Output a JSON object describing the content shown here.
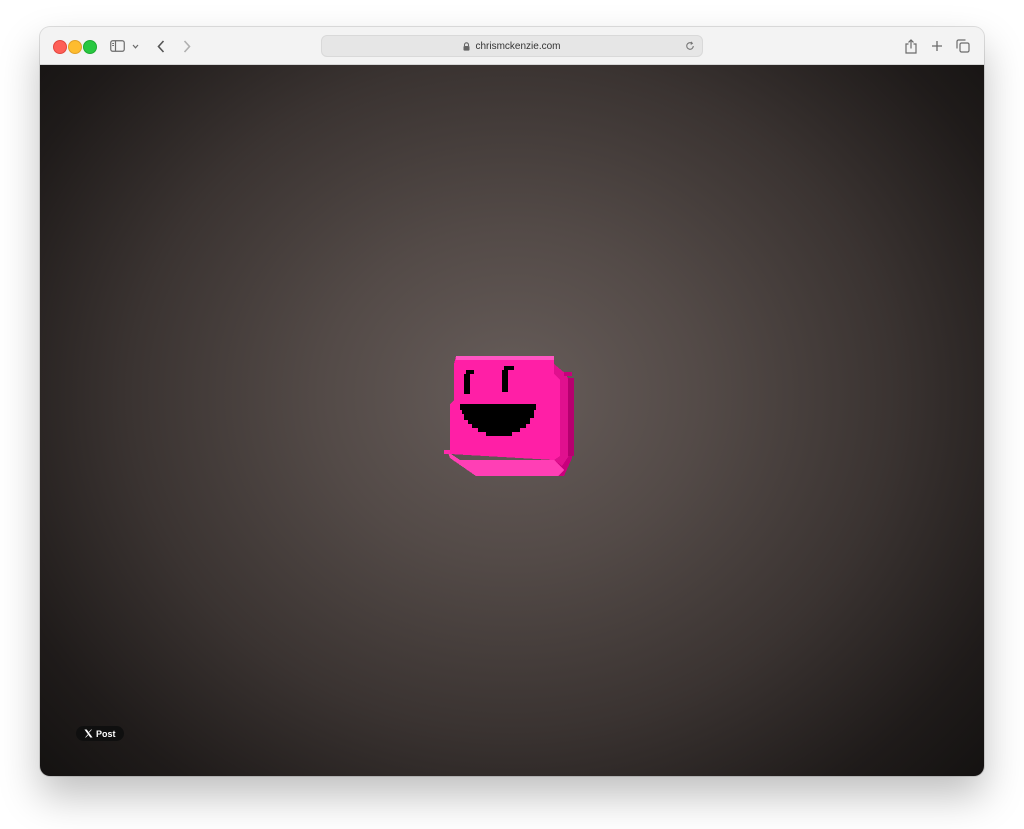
{
  "browser": {
    "url": "chrismckenzie.com"
  },
  "page": {
    "post_button": {
      "label": "Post",
      "icon": "x-logo-icon"
    },
    "character": {
      "icon": "smiling-cube-character",
      "color": "#ff1fa6"
    }
  }
}
